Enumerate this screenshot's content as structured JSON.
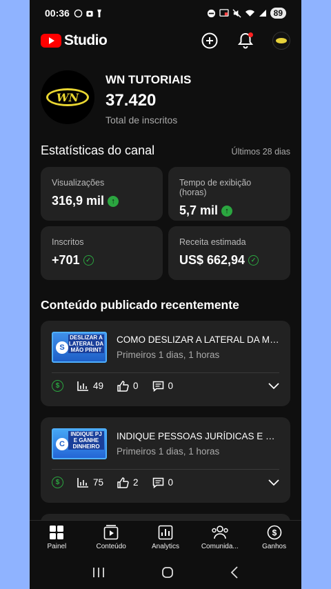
{
  "status_bar": {
    "time": "00:36",
    "battery": "89"
  },
  "header": {
    "logo_text": "Studio"
  },
  "channel": {
    "name": "WN TUTORIAIS",
    "subscribers": "37.420",
    "subscribers_label": "Total de inscritos",
    "avatar_text": "WN"
  },
  "stats": {
    "title": "Estatísticas do canal",
    "range": "Últimos 28 dias",
    "cards": [
      {
        "label": "Visualizações",
        "value": "316,9 mil",
        "indicator": "up"
      },
      {
        "label": "Tempo de exibição (horas)",
        "value": "5,7 mil",
        "indicator": "up"
      },
      {
        "label": "Inscritos",
        "value": "+701",
        "indicator": "check"
      },
      {
        "label": "Receita estimada",
        "value": "US$ 662,94",
        "indicator": "check"
      }
    ]
  },
  "recent": {
    "title": "Conteúdo publicado recentemente",
    "videos": [
      {
        "title": "COMO DESLIZAR A LATERAL DA MÃO PRINT",
        "subtitle": "Primeiros 1 dias, 1 horas",
        "views": "49",
        "likes": "0",
        "comments": "0",
        "thumb_text": "DESLIZAR A LATERAL DA MÃO PRINT",
        "thumb_mark": "S"
      },
      {
        "title": "INDIQUE PESSOAS JURÍDICAS E GANHE DINHEIRO",
        "subtitle": "Primeiros 1 dias, 1 horas",
        "views": "75",
        "likes": "2",
        "comments": "0",
        "thumb_text": "INDIQUE PJ E GANHE DINHEIRO",
        "thumb_mark": "C"
      }
    ]
  },
  "bottom_nav": [
    {
      "label": "Painel",
      "icon": "dashboard-icon"
    },
    {
      "label": "Conteúdo",
      "icon": "content-icon"
    },
    {
      "label": "Analytics",
      "icon": "analytics-icon"
    },
    {
      "label": "Comunida...",
      "icon": "community-icon"
    },
    {
      "label": "Ganhos",
      "icon": "earn-icon"
    }
  ],
  "colors": {
    "accent_green": "#2ba640",
    "brand_red": "#ff0000",
    "background": "#0f0f0f",
    "card": "#222222"
  }
}
